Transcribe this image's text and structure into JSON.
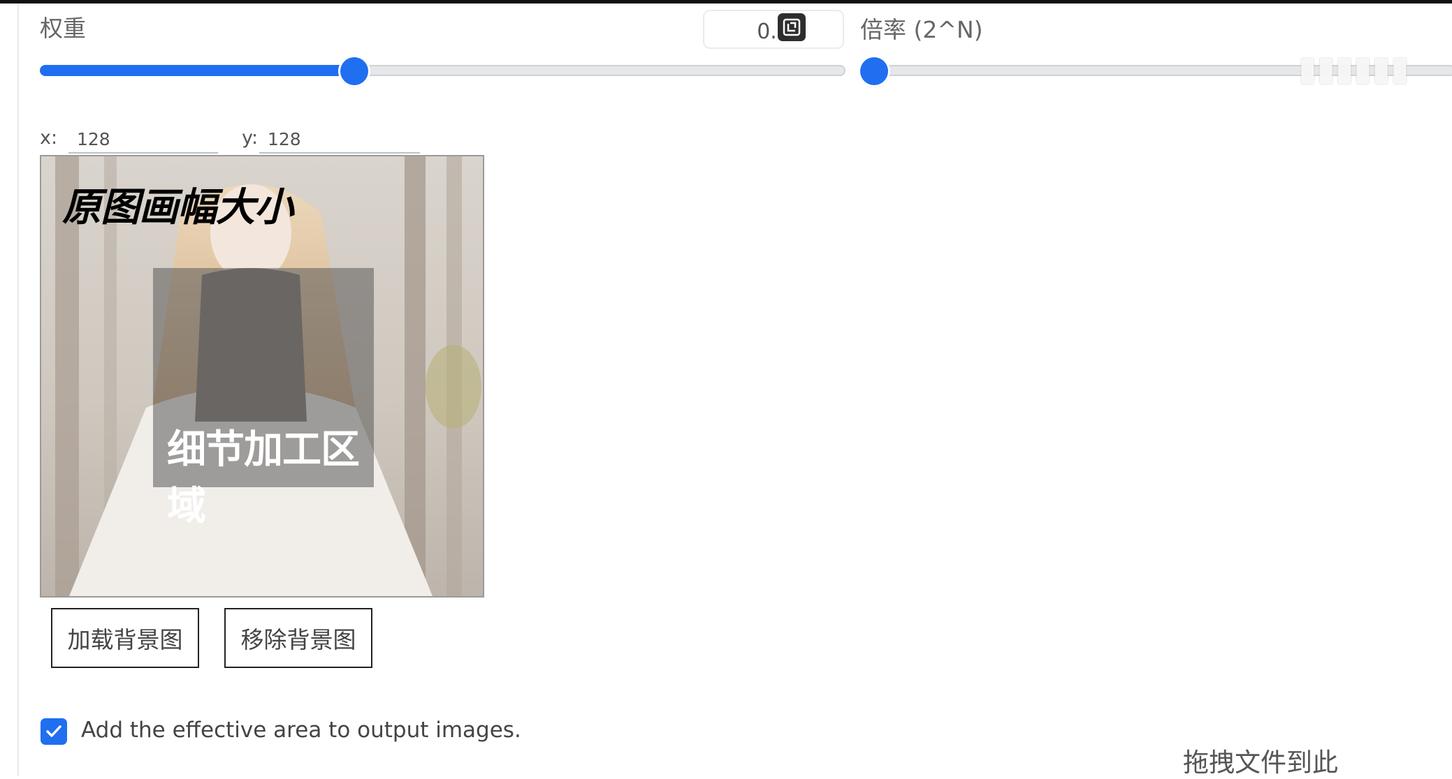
{
  "weight": {
    "label": "权重",
    "value_display": "0.15",
    "fraction": 0.39
  },
  "scale": {
    "label": "倍率 (2^N)",
    "fraction": 0.0
  },
  "offset": {
    "x_label": "x:",
    "x_value": "128",
    "y_label": "y:",
    "y_value": "128"
  },
  "canvas": {
    "title": "原图画幅大小",
    "region_label": "细节加工区域"
  },
  "buttons": {
    "load_bg": "加载背景图",
    "remove_bg": "移除背景图"
  },
  "effective_area": {
    "checked": true,
    "label": "Add the effective area to output images."
  },
  "dropzone": {
    "label": "拖拽文件到此"
  },
  "colors": {
    "accent": "#1f6ff0"
  },
  "icons": {
    "reset": "reset-icon",
    "check": "checkmark-icon"
  }
}
